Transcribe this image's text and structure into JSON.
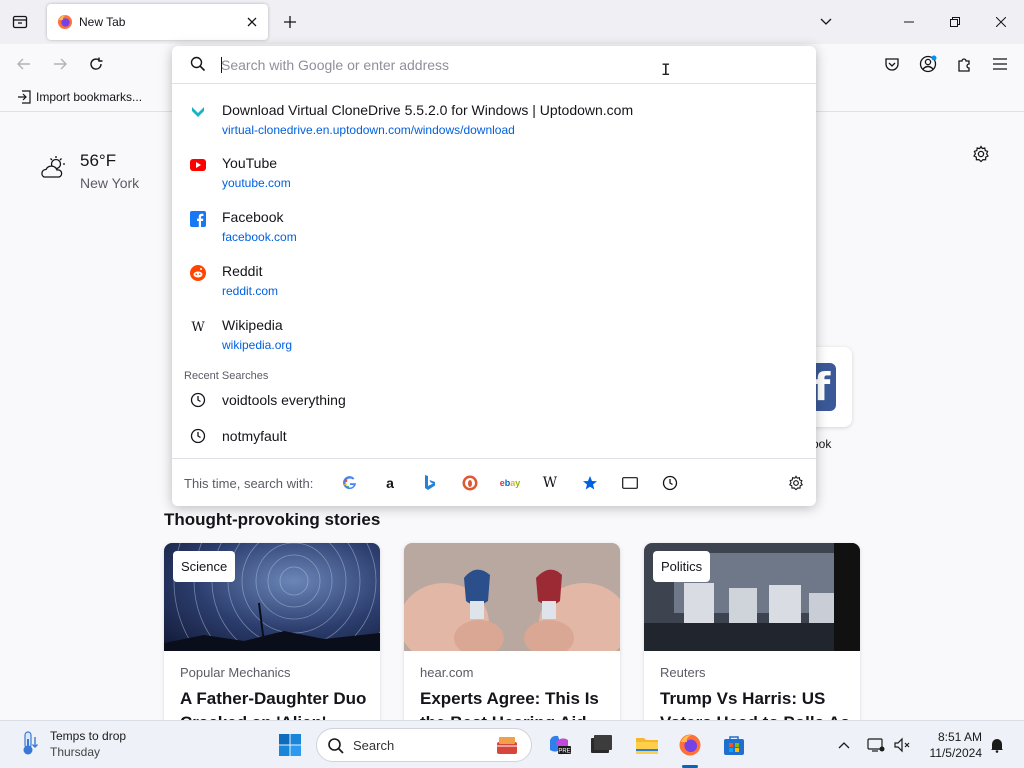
{
  "browser": {
    "tab": {
      "title": "New Tab"
    },
    "nav": {
      "back_label": "Back",
      "forward_label": "Forward",
      "reload_label": "Reload"
    },
    "bookmarks": {
      "import_label": "Import bookmarks..."
    }
  },
  "urlbar": {
    "placeholder": "Search with Google or enter address",
    "value": "",
    "results": [
      {
        "title": "Download Virtual CloneDrive 5.5.2.0 for Windows | Uptodown.com",
        "url": "virtual-clonedrive.en.uptodown.com/windows/download",
        "icon": "uptodown-icon"
      },
      {
        "title": "YouTube",
        "url": "youtube.com",
        "icon": "youtube-icon"
      },
      {
        "title": "Facebook",
        "url": "facebook.com",
        "icon": "facebook-icon"
      },
      {
        "title": "Reddit",
        "url": "reddit.com",
        "icon": "reddit-icon"
      },
      {
        "title": "Wikipedia",
        "url": "wikipedia.org",
        "icon": "wikipedia-icon"
      }
    ],
    "recent_label": "Recent Searches",
    "recent": [
      "voidtools everything",
      "notmyfault"
    ],
    "oneoff_label": "This time, search with:",
    "oneoff_engines": [
      "google-icon",
      "amazon-icon",
      "bing-icon",
      "duckduckgo-icon",
      "ebay-icon",
      "wikipedia-icon",
      "bookmarks-icon",
      "tabs-icon",
      "history-icon"
    ]
  },
  "newtab": {
    "weather": {
      "temp": "56°F",
      "city": "New York"
    },
    "shortcut_label": "ook",
    "stories_heading": "Thought-provoking stories",
    "stories": [
      {
        "tag": "Science",
        "source": "Popular Mechanics",
        "title": "A Father-Daughter Duo Cracked an 'Alien' Code"
      },
      {
        "tag": "",
        "source": "hear.com",
        "title": "Experts Agree: This Is the Best Hearing Aid"
      },
      {
        "tag": "Politics",
        "source": "Reuters",
        "title": "Trump Vs Harris: US Voters Head to Polls As"
      }
    ]
  },
  "taskbar": {
    "weather_line1": "Temps to drop",
    "weather_line2": "Thursday",
    "search_label": "Search",
    "time": "8:51 AM",
    "date": "11/5/2024"
  },
  "colors": {
    "accent": "#0061e0",
    "firefox_orange": "#ff7139",
    "youtube_red": "#ff0000",
    "facebook_blue": "#1877f2",
    "reddit_orange": "#ff4500"
  }
}
